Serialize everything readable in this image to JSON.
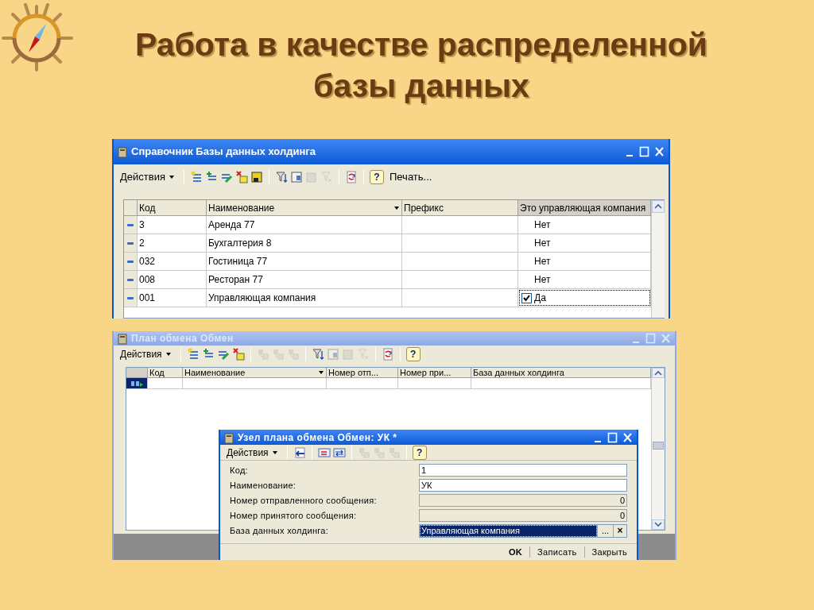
{
  "slide_title": "Работа в качестве распределенной базы данных",
  "catalog_window": {
    "title": "Справочник Базы данных холдинга",
    "actions": "Действия",
    "help": "?",
    "print": "Печать...",
    "columns": [
      "Код",
      "Наименование",
      "Префикс",
      "Это управляющая компания"
    ],
    "rows": [
      {
        "code": "3",
        "name": "Аренда 77",
        "flag": "Нет",
        "checked": false
      },
      {
        "code": "2",
        "name": "Бухгалтерия 8",
        "flag": "Нет",
        "checked": false
      },
      {
        "code": "032",
        "name": "Гостиница 77",
        "flag": "Нет",
        "checked": false
      },
      {
        "code": "008",
        "name": "Ресторан 77",
        "flag": "Нет",
        "checked": false
      },
      {
        "code": "001",
        "name": "Управляющая компания",
        "flag": "Да",
        "checked": true
      }
    ]
  },
  "exchange_window": {
    "title": "План обмена Обмен",
    "active": false,
    "actions": "Действия",
    "help": "?",
    "columns": [
      "Код",
      "Наименование",
      "Номер отп...",
      "Номер при...",
      "База данных холдинга"
    ]
  },
  "node_window": {
    "title": "Узел плана обмена Обмен: УК *",
    "active": true,
    "actions": "Действия",
    "help": "?",
    "fields": [
      {
        "label": "Код:",
        "value": "1",
        "kind": "text"
      },
      {
        "label": "Наименование:",
        "value": "УК",
        "kind": "text"
      },
      {
        "label": "Номер отправленного сообщения:",
        "value": "0",
        "kind": "readonly"
      },
      {
        "label": "Номер принятого сообщения:",
        "value": "0",
        "kind": "readonly"
      },
      {
        "label": "База данных холдинга:",
        "value": "Управляющая компания",
        "kind": "select",
        "choose": "...",
        "clear": "×"
      }
    ],
    "buttons": [
      {
        "label": "OK",
        "default": true
      },
      {
        "label": "Записать",
        "default": false
      },
      {
        "label": "Закрыть",
        "default": false
      }
    ]
  }
}
